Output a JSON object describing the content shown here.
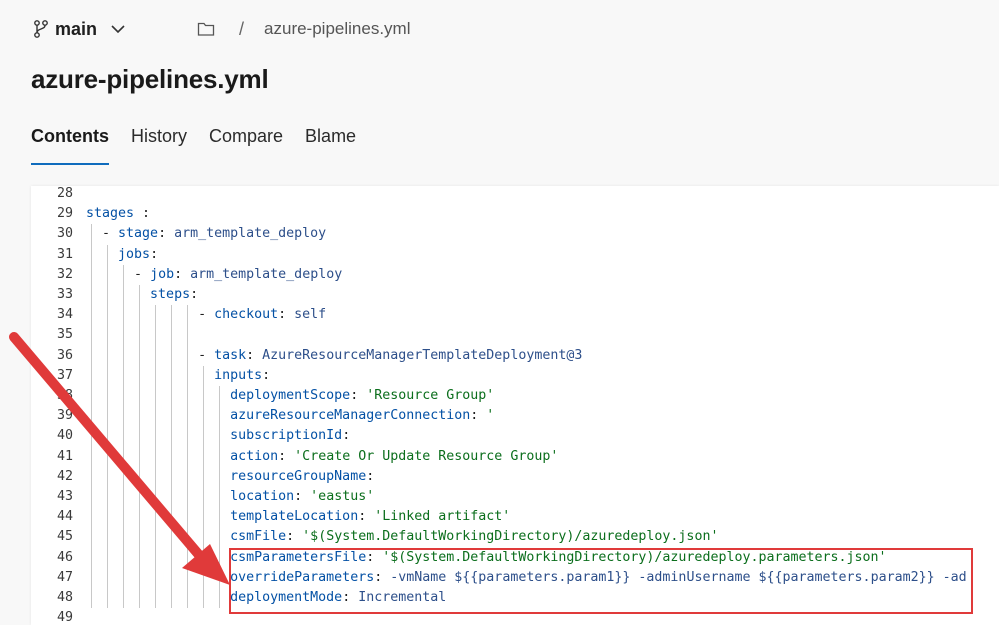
{
  "header": {
    "branch": "main",
    "breadcrumb_sep": "/",
    "breadcrumb_file": "azure-pipelines.yml"
  },
  "title": "azure-pipelines.yml",
  "tabs": [
    "Contents",
    "History",
    "Compare",
    "Blame"
  ],
  "code": [
    {
      "n": "28",
      "t": ""
    },
    {
      "n": "29",
      "t": "stages :"
    },
    {
      "n": "30",
      "t": "  - stage: arm_template_deploy"
    },
    {
      "n": "31",
      "t": "    jobs:"
    },
    {
      "n": "32",
      "t": "      - job: arm_template_deploy"
    },
    {
      "n": "33",
      "t": "        steps:"
    },
    {
      "n": "34",
      "t": "              - checkout: self"
    },
    {
      "n": "35",
      "t": ""
    },
    {
      "n": "36",
      "t": "              - task: AzureResourceManagerTemplateDeployment@3"
    },
    {
      "n": "37",
      "t": "                inputs:"
    },
    {
      "n": "38",
      "t": "                  deploymentScope: 'Resource Group'"
    },
    {
      "n": "39",
      "t": "                  azureResourceManagerConnection: '"
    },
    {
      "n": "40",
      "t": "                  subscriptionId:"
    },
    {
      "n": "41",
      "t": "                  action: 'Create Or Update Resource Group'"
    },
    {
      "n": "42",
      "t": "                  resourceGroupName:"
    },
    {
      "n": "43",
      "t": "                  location: 'eastus'"
    },
    {
      "n": "44",
      "t": "                  templateLocation: 'Linked artifact'"
    },
    {
      "n": "45",
      "t": "                  csmFile: '$(System.DefaultWorkingDirectory)/azuredeploy.json'"
    },
    {
      "n": "46",
      "t": "                  csmParametersFile: '$(System.DefaultWorkingDirectory)/azuredeploy.parameters.json'"
    },
    {
      "n": "47",
      "t": "                  overrideParameters: -vmName ${{parameters.param1}} -adminUsername ${{parameters.param2}} -ad"
    },
    {
      "n": "48",
      "t": "                  deploymentMode: Incremental"
    },
    {
      "n": "49",
      "t": ""
    }
  ],
  "colors": {
    "accent": "#0f6cbd",
    "annotation": "#e03a3a"
  }
}
